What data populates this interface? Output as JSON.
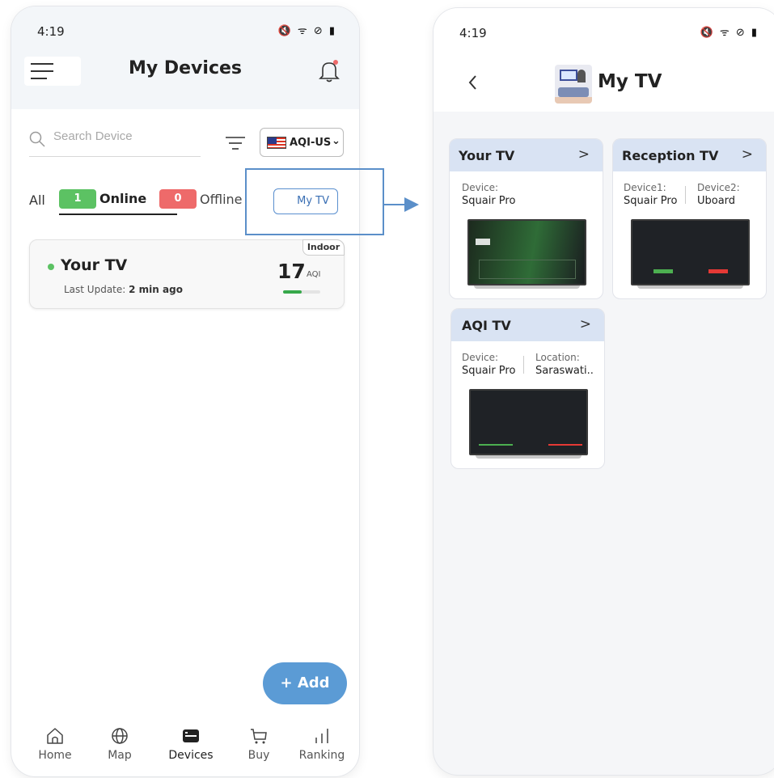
{
  "left": {
    "status_time": "4:19",
    "status_icons": "🔇 ᯤ ⊘ ▮",
    "title": "My Devices",
    "search": {
      "placeholder": "Search Device",
      "value": ""
    },
    "region": "AQI-US",
    "tabs": {
      "all": "All",
      "online_count": "1",
      "online": "Online",
      "offline_count": "0",
      "offline": "Offline"
    },
    "my_tv_button": "My TV",
    "device": {
      "tag": "Indoor",
      "name": "Your TV",
      "last_update_label": "Last Update:",
      "last_update_value": "2 min ago",
      "aqi": "17",
      "aqi_unit": "AQI",
      "aqi_level": 0.5
    },
    "add_button": "+ Add",
    "nav": [
      "Home",
      "Map",
      "Devices",
      "Buy",
      "Ranking"
    ],
    "active_nav": "Devices",
    "colors": {
      "online": "#5cc263",
      "offline": "#ee6a6a",
      "accent": "#5b9bd5"
    }
  },
  "right": {
    "status_time": "4:19",
    "status_icons": "🔇 ᯤ ⊘ ▮",
    "title": "My TV",
    "tvs": [
      {
        "title": "Your TV",
        "fields": [
          {
            "label": "Device:",
            "value": "Squair Pro"
          }
        ]
      },
      {
        "title": "Reception TV",
        "fields": [
          {
            "label": "Device1:",
            "value": "Squair Pro"
          },
          {
            "label": "Device2:",
            "value": "Uboard"
          }
        ]
      },
      {
        "title": "AQI TV",
        "fields": [
          {
            "label": "Device:",
            "value": "Squair Pro"
          },
          {
            "label": "Location:",
            "value": "Saraswati.."
          }
        ]
      }
    ],
    "card_chevron": ">"
  }
}
